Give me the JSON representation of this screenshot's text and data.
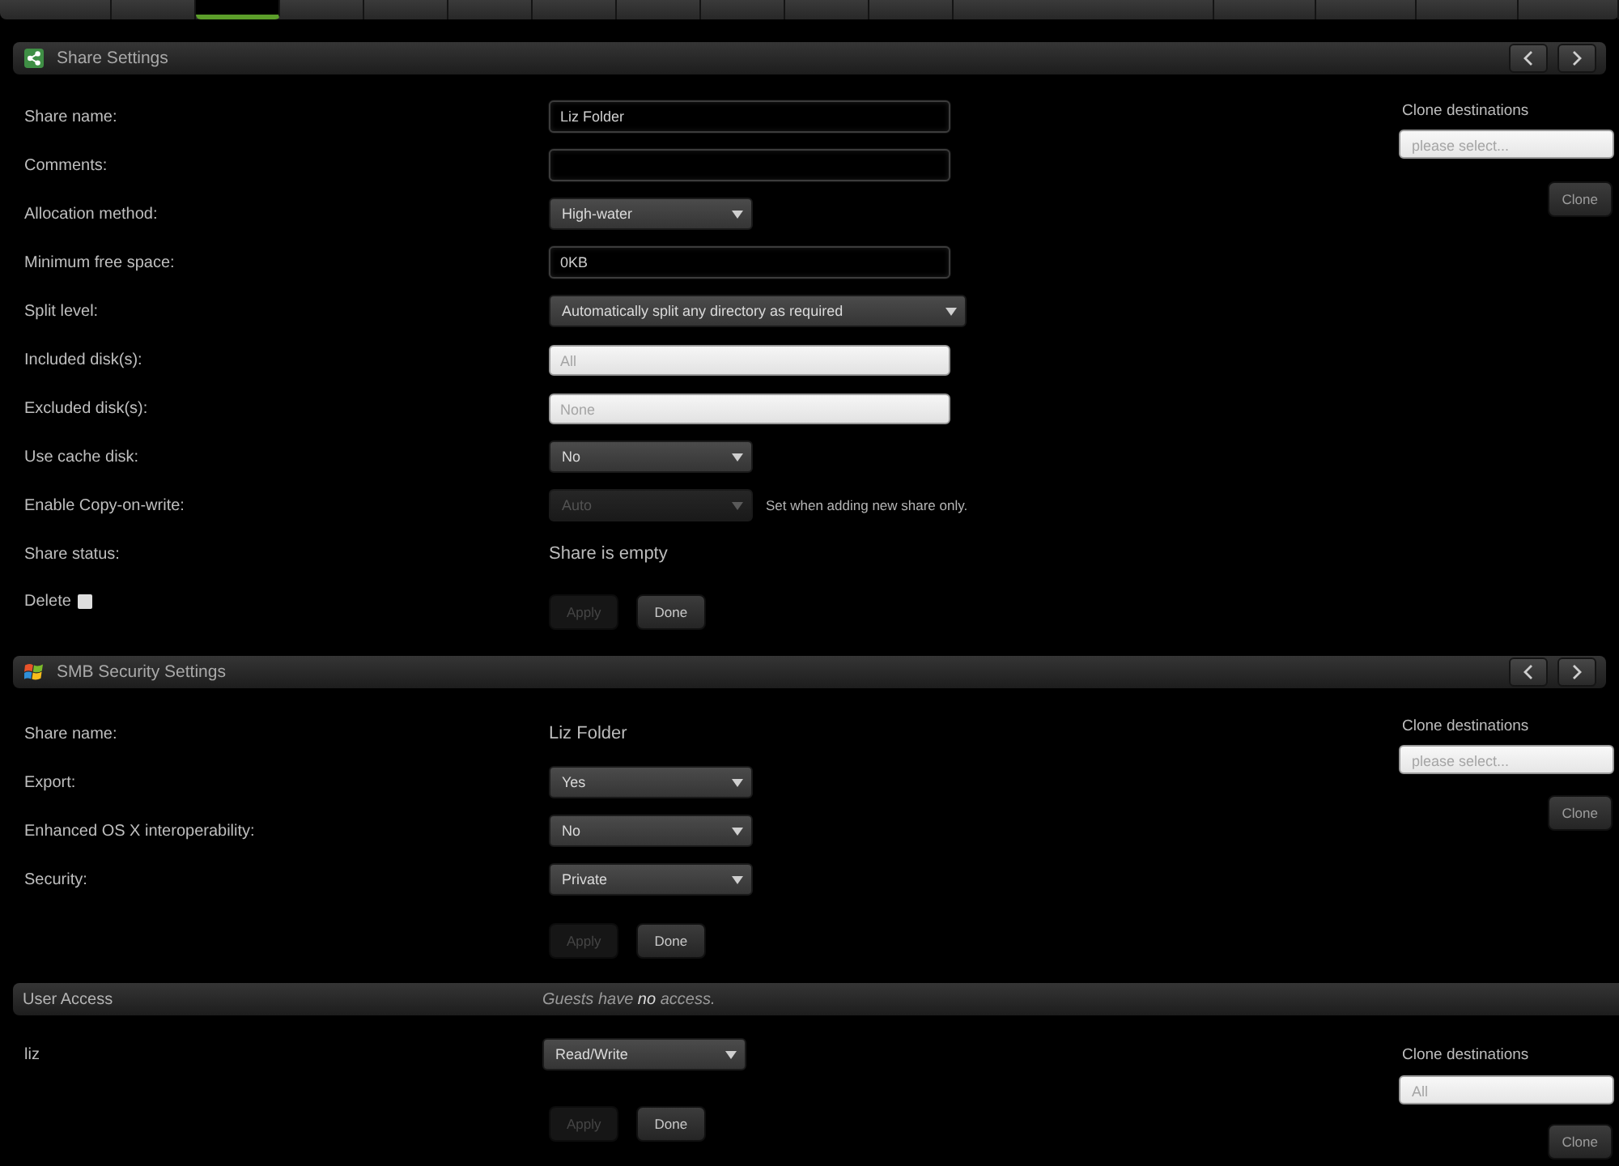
{
  "top_nav": {
    "left_tabs": [
      {
        "selected": false
      },
      {
        "selected": false
      },
      {
        "selected": true
      },
      {
        "selected": false
      },
      {
        "selected": false
      },
      {
        "selected": false
      },
      {
        "selected": false
      },
      {
        "selected": false
      },
      {
        "selected": false
      },
      {
        "selected": false
      },
      {
        "selected": false
      }
    ],
    "right_tabs": [
      {
        "selected": false
      },
      {
        "selected": false
      },
      {
        "selected": false
      },
      {
        "selected": false
      }
    ]
  },
  "share_settings": {
    "title": "Share Settings",
    "fields": [
      {
        "kind": "text",
        "label": "Share name:",
        "value": "Liz Folder"
      },
      {
        "kind": "text",
        "label": "Comments:"
      },
      {
        "kind": "select",
        "label": "Allocation method:",
        "value": "High-water",
        "disabled": false
      },
      {
        "kind": "text",
        "label": "Minimum free space:",
        "value": "0KB"
      },
      {
        "kind": "select",
        "label": "Split level:",
        "value": "Automatically split any directory as required",
        "disabled": false
      },
      {
        "kind": "multiselect",
        "label": "Included disk(s):",
        "placeholder": "All"
      },
      {
        "kind": "multiselect",
        "label": "Excluded disk(s):",
        "placeholder": "None"
      },
      {
        "kind": "select",
        "label": "Use cache disk:",
        "value": "No",
        "disabled": false
      },
      {
        "kind": "select",
        "label": "Enable Copy-on-write:",
        "value": "Auto",
        "disabled": true,
        "note": "Set when adding new share only."
      },
      {
        "kind": "static",
        "label": "Share status:",
        "value": "Share is empty"
      }
    ],
    "delete": {
      "label": "Delete",
      "checked": false
    },
    "buttons": [
      {
        "label": "Apply",
        "disabled": true
      },
      {
        "label": "Done",
        "disabled": false
      }
    ],
    "clone": {
      "label": "Clone destinations",
      "placeholder": "please select...",
      "button": "Clone"
    }
  },
  "smb_security": {
    "title": "SMB Security Settings",
    "fields": [
      {
        "kind": "static",
        "label": "Share name:",
        "value": "Liz Folder"
      },
      {
        "kind": "select",
        "label": "Export:",
        "value": "Yes",
        "disabled": false
      },
      {
        "kind": "select",
        "label": "Enhanced OS X interoperability:",
        "value": "No",
        "disabled": false
      },
      {
        "kind": "select",
        "label": "Security:",
        "value": "Private",
        "disabled": false
      }
    ],
    "buttons": [
      {
        "label": "Apply",
        "disabled": true
      },
      {
        "label": "Done",
        "disabled": false
      }
    ],
    "clone": {
      "label": "Clone destinations",
      "placeholder": "please select...",
      "button": "Clone"
    }
  },
  "user_access": {
    "title": "User Access",
    "note": "Guests have **no** access.",
    "users": [
      {
        "name": "liz",
        "value": "Read/Write",
        "disabled": false
      }
    ],
    "buttons": [
      {
        "label": "Apply",
        "disabled": true
      },
      {
        "label": "Done",
        "disabled": false
      }
    ],
    "clone": {
      "label": "Clone destinations",
      "placeholder": "All",
      "button": "Clone"
    }
  }
}
